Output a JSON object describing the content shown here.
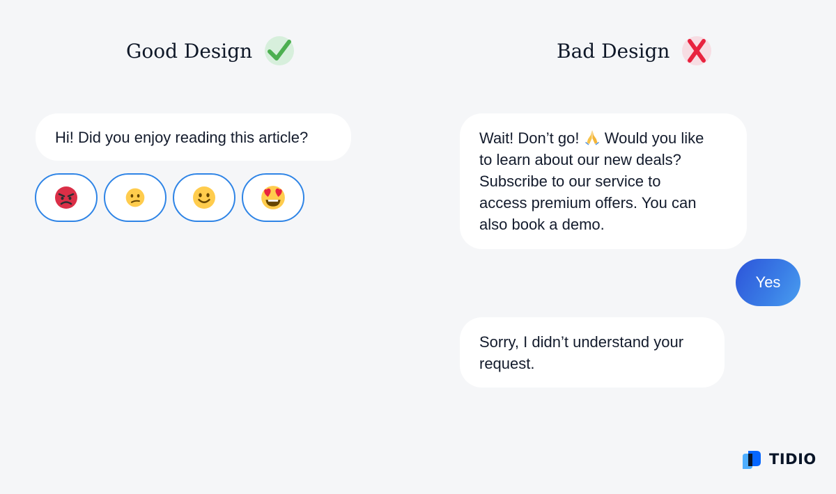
{
  "headings": {
    "good": "Good Design",
    "bad": "Bad Design"
  },
  "good_chat": {
    "question": "Hi! Did you enjoy reading this article?",
    "reactions": [
      {
        "icon": "angry-face-icon",
        "label": "angry"
      },
      {
        "icon": "confused-face-icon",
        "label": "confused"
      },
      {
        "icon": "slightly-smiling-face-icon",
        "label": "smiling"
      },
      {
        "icon": "heart-eyes-face-icon",
        "label": "heart-eyes"
      }
    ]
  },
  "bad_chat": {
    "bot_message_1": {
      "line1_before_emoji": "Wait! Don’t go!",
      "emoji_icon": "folded-hands-icon",
      "line1_after_emoji": "Would you like",
      "line2": "to learn about our new deals?",
      "line3": "Subscribe to our service to",
      "line4": "access premium offers. You can",
      "line5": "also book a demo."
    },
    "user_reply": "Yes",
    "bot_message_2": {
      "line1": "Sorry, I didn’t understand your",
      "line2": "request."
    }
  },
  "logo": {
    "text": "TIDIO"
  },
  "colors": {
    "background": "#f5f6f8",
    "accent_blue": "#2e84e6",
    "check_green": "#4caf50",
    "cross_red": "#e8233f"
  }
}
